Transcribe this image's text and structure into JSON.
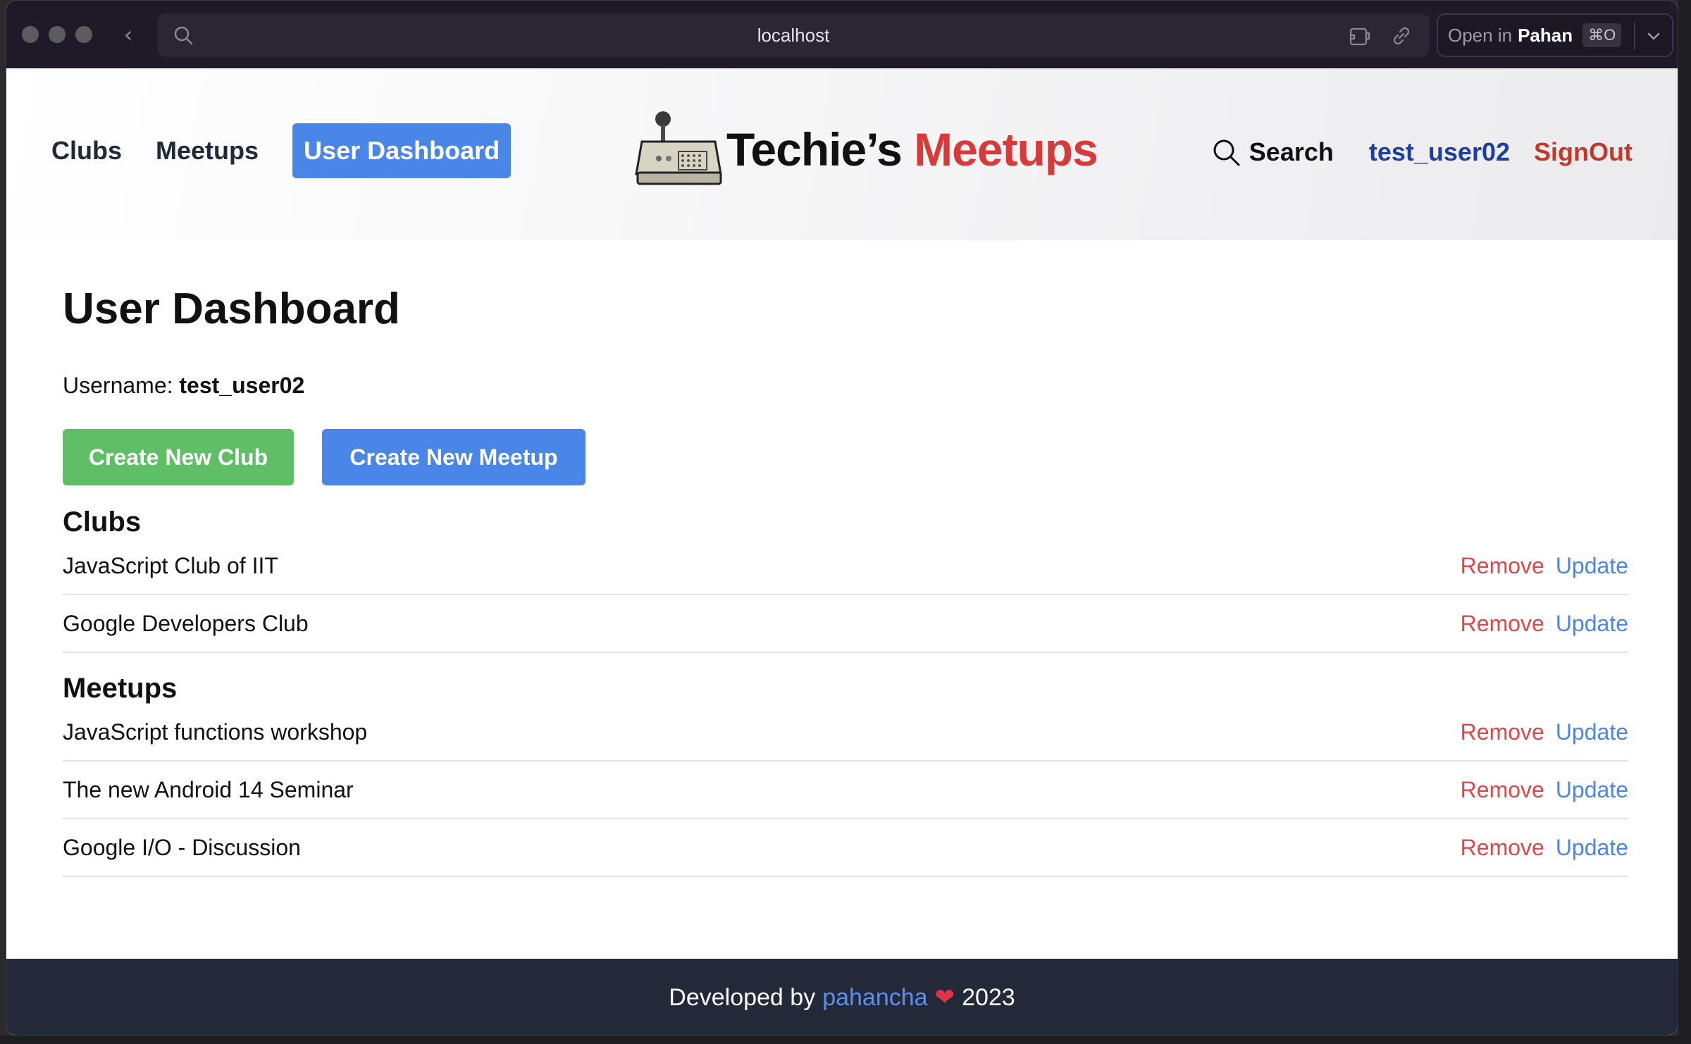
{
  "browser": {
    "url": "localhost",
    "open_in_prefix": "Open in",
    "open_in_app": "Pahan",
    "shortcut": "⌘O"
  },
  "nav": {
    "clubs": "Clubs",
    "meetups": "Meetups",
    "dashboard": "User Dashboard",
    "logo_main": "Techie’s",
    "logo_accent": "Meetups",
    "search": "Search",
    "user": "test_user02",
    "signout": "SignOut"
  },
  "dashboard": {
    "title": "User Dashboard",
    "username_label": "Username:",
    "username_value": "test_user02",
    "create_club": "Create New Club",
    "create_meetup": "Create New Meetup"
  },
  "clubs": {
    "heading": "Clubs",
    "items": [
      {
        "name": "JavaScript Club of IIT",
        "remove": "Remove",
        "update": "Update"
      },
      {
        "name": "Google Developers Club",
        "remove": "Remove",
        "update": "Update"
      }
    ]
  },
  "meetups": {
    "heading": "Meetups",
    "items": [
      {
        "name": "JavaScript functions workshop",
        "remove": "Remove",
        "update": "Update"
      },
      {
        "name": "The new Android 14 Seminar",
        "remove": "Remove",
        "update": "Update"
      },
      {
        "name": "Google I/O - Discussion",
        "remove": "Remove",
        "update": "Update"
      }
    ]
  },
  "footer": {
    "prefix": "Developed by",
    "author": "pahancha",
    "heart": "❤",
    "year": "2023"
  },
  "colors": {
    "primary": "#4a86e8",
    "success": "#5fbf66",
    "danger": "#e0454a",
    "brand_accent": "#d63a3a",
    "footer_bg": "#232938"
  }
}
